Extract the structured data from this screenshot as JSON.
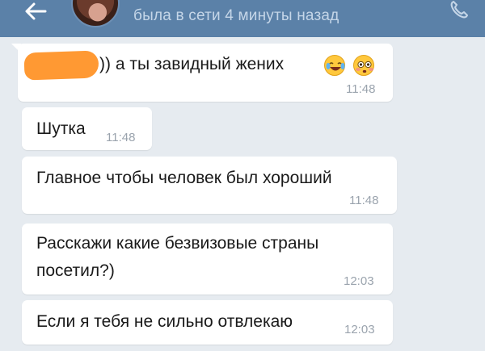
{
  "header": {
    "status": "была в сети 4 минуты назад"
  },
  "messages": [
    {
      "text": ")) а ты завидный жених",
      "time": "11:48",
      "emojis": [
        "laughing-crying-emoji",
        "flushed-emoji"
      ],
      "redacted_name": true
    },
    {
      "text": "Шутка",
      "time": "11:48"
    },
    {
      "text": "Главное чтобы человек был хороший",
      "time": "11:48"
    },
    {
      "text": "Расскажи какие безвизовые страны\nпосетил?)",
      "line1": "Расскажи какие безвизовые страны",
      "line2": "посетил?)",
      "time": "12:03"
    },
    {
      "text": "Если я тебя не сильно отвлекаю",
      "time": "12:03"
    }
  ],
  "colors": {
    "header_bg": "#5b81a8",
    "chat_bg": "#e6ebf0",
    "bubble_bg": "#ffffff",
    "redaction": "#ff9933"
  }
}
